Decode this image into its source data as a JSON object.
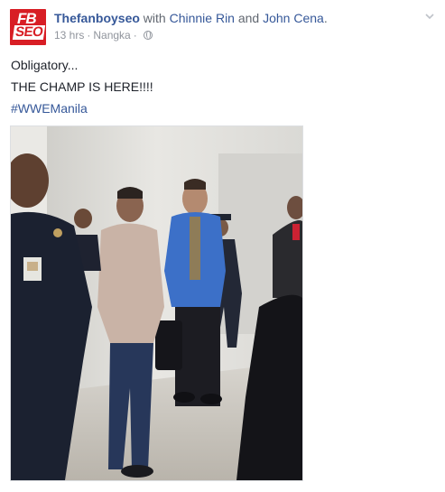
{
  "post": {
    "author": "Thefanboyseo",
    "with_text": "with",
    "tagged_1": "Chinnie Rin",
    "and_text": "and",
    "tagged_2": "John Cena",
    "end_punct": ".",
    "time": "13 hrs",
    "location": "Nangka",
    "privacy_icon": "globe-icon",
    "lines": [
      "Obligatory...",
      "THE CHAMP IS HERE!!!!",
      "#WWEManila"
    ],
    "avatar_text_top": "FB",
    "avatar_text_bottom": "SEO"
  },
  "colors": {
    "link": "#365899",
    "meta": "#90949c",
    "avatar": "#d81e25"
  }
}
